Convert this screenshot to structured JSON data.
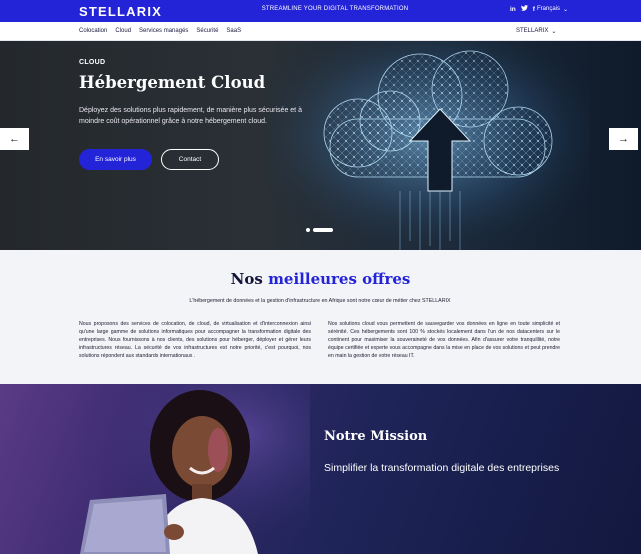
{
  "topbar": {
    "logo": "STELLARIX",
    "tagline": "STREAMLINE YOUR DIGITAL TRANSFORMATION",
    "social": {
      "linkedin": "in",
      "twitter": "🐦",
      "facebook": "f"
    },
    "language": "Français",
    "icons": {
      "language_chevron": "chevron-down-icon"
    }
  },
  "nav": {
    "items": [
      "Colocation",
      "Cloud",
      "Services managés",
      "Sécurité",
      "SaaS"
    ],
    "right_menu": "STELLARIX"
  },
  "hero": {
    "kicker": "CLOUD",
    "title": "Hébergement Cloud",
    "description": "Déployez des solutions plus rapidement, de manière plus sécurisée et à moindre coût opérationnel grâce à notre hébergement cloud.",
    "primary_button": "En savoir plus",
    "secondary_button": "Contact",
    "prev_arrow": "←",
    "next_arrow": "→"
  },
  "offres": {
    "title_part1": "Nos",
    "title_part2": "meilleures offres",
    "intro": "L'hébergement de données et la gestion d'infrastructure en Afrique sont notre cœur de métier chez STELLARIX",
    "col_left": "Nous proposons des services de colocation, de cloud, de virtualisation et d'interconnexion ainsi qu'une large gamme de solutions informatiques pour accompagner la transformation digitale des entreprises. Nous fournissons à nos clients, des solutions pour héberger, déployer et gérer leurs infrastructures réseau. La sécurité de vos infrastructures est notre priorité, c'est pourquoi, nos solutions  répondent aux standards internationaux .",
    "col_right": "Nos solutions cloud vous permettent de sauvegarder vos données en ligne en toute simplicité et sérénité. Ces hébergements sont 100 % stockés localement dans l'un de nos datacenters sur le continent pour maximiser la souveraineté de vos données. Afin d'assurer votre tranquillité, notre équipe certifiée et experte vous accompagne dans la mise en place de vos solutions et peut prendre en main la gestion de votre réseau IT."
  },
  "mission": {
    "title": "Notre Mission",
    "subtitle": "Simplifier la transformation digitale des entreprises"
  },
  "colors": {
    "brand_blue": "#2323d8",
    "dark_navy": "#14143a",
    "section_bg": "#f3f4f8"
  }
}
